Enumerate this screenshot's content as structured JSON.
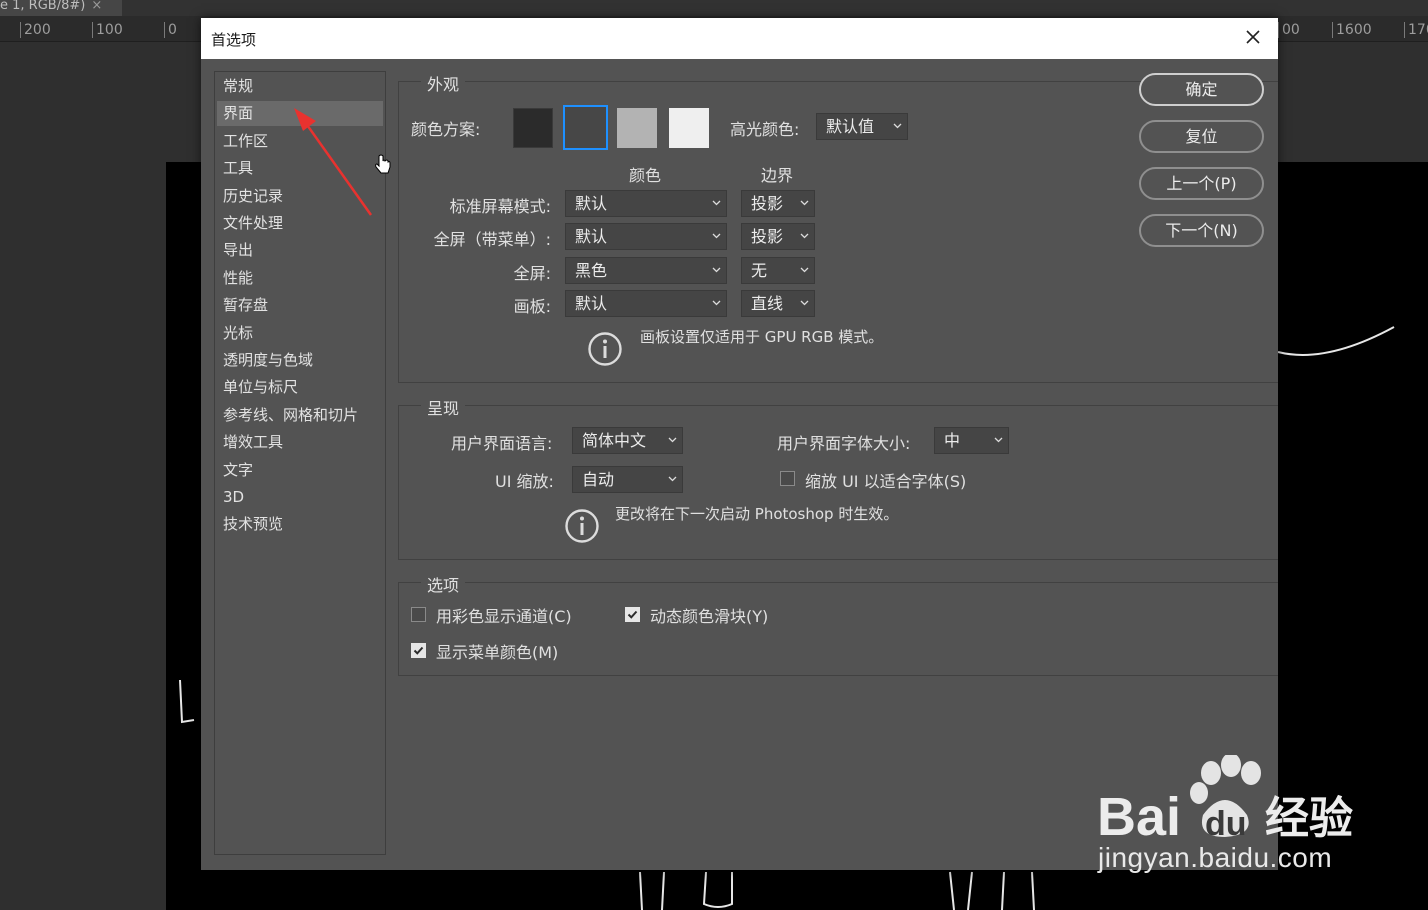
{
  "workspace": {
    "tab_label": "e 1, RGB/8#)",
    "tab_close": "×",
    "ruler_ticks": [
      "200",
      "100",
      "0",
      "00",
      "1600",
      "170"
    ]
  },
  "dialog": {
    "title": "首选项",
    "sidebar": [
      "常规",
      "界面",
      "工作区",
      "工具",
      "历史记录",
      "文件处理",
      "导出",
      "性能",
      "暂存盘",
      "光标",
      "透明度与色域",
      "单位与标尺",
      "参考线、网格和切片",
      "增效工具",
      "文字",
      "3D",
      "技术预览"
    ],
    "sidebar_active": 1,
    "appearance": {
      "group_label": "外观",
      "color_scheme_label": "颜色方案:",
      "swatches": [
        "#2b2b2b",
        "#474747",
        "#b3b3b3",
        "#efefef"
      ],
      "highlight_label": "高光颜色:",
      "highlight_value": "默认值",
      "col_color": "颜色",
      "col_border": "边界",
      "rows": [
        {
          "label": "标准屏幕模式:",
          "color": "默认",
          "border": "投影"
        },
        {
          "label": "全屏（带菜单）:",
          "color": "默认",
          "border": "投影"
        },
        {
          "label": "全屏:",
          "color": "黑色",
          "border": "无"
        },
        {
          "label": "画板:",
          "color": "默认",
          "border": "直线"
        }
      ],
      "note": "画板设置仅适用于 GPU RGB 模式。"
    },
    "presentation": {
      "group_label": "呈现",
      "ui_language_label": "用户界面语言:",
      "ui_language_value": "简体中文",
      "ui_font_size_label": "用户界面字体大小:",
      "ui_font_size_value": "中",
      "ui_scale_label": "UI 缩放:",
      "ui_scale_value": "自动",
      "scale_to_font_label": "缩放 UI 以适合字体(S)",
      "note": "更改将在下一次启动 Photoshop 时生效。"
    },
    "options": {
      "group_label": "选项",
      "color_channels_label": "用彩色显示通道(C)",
      "color_channels_checked": false,
      "dynamic_sliders_label": "动态颜色滑块(Y)",
      "dynamic_sliders_checked": true,
      "menu_colors_label": "显示菜单颜色(M)",
      "menu_colors_checked": true
    },
    "buttons": {
      "ok": "确定",
      "reset": "复位",
      "prev": "上一个(P)",
      "next": "下一个(N)"
    }
  },
  "watermark": {
    "text": "jingyan.baidu.com",
    "logo_bai": "Bai",
    "logo_du": "du",
    "logo_cn": "经验"
  },
  "colors": {
    "dialog_bg": "#535353",
    "annotation_arrow": "#e8322f"
  }
}
